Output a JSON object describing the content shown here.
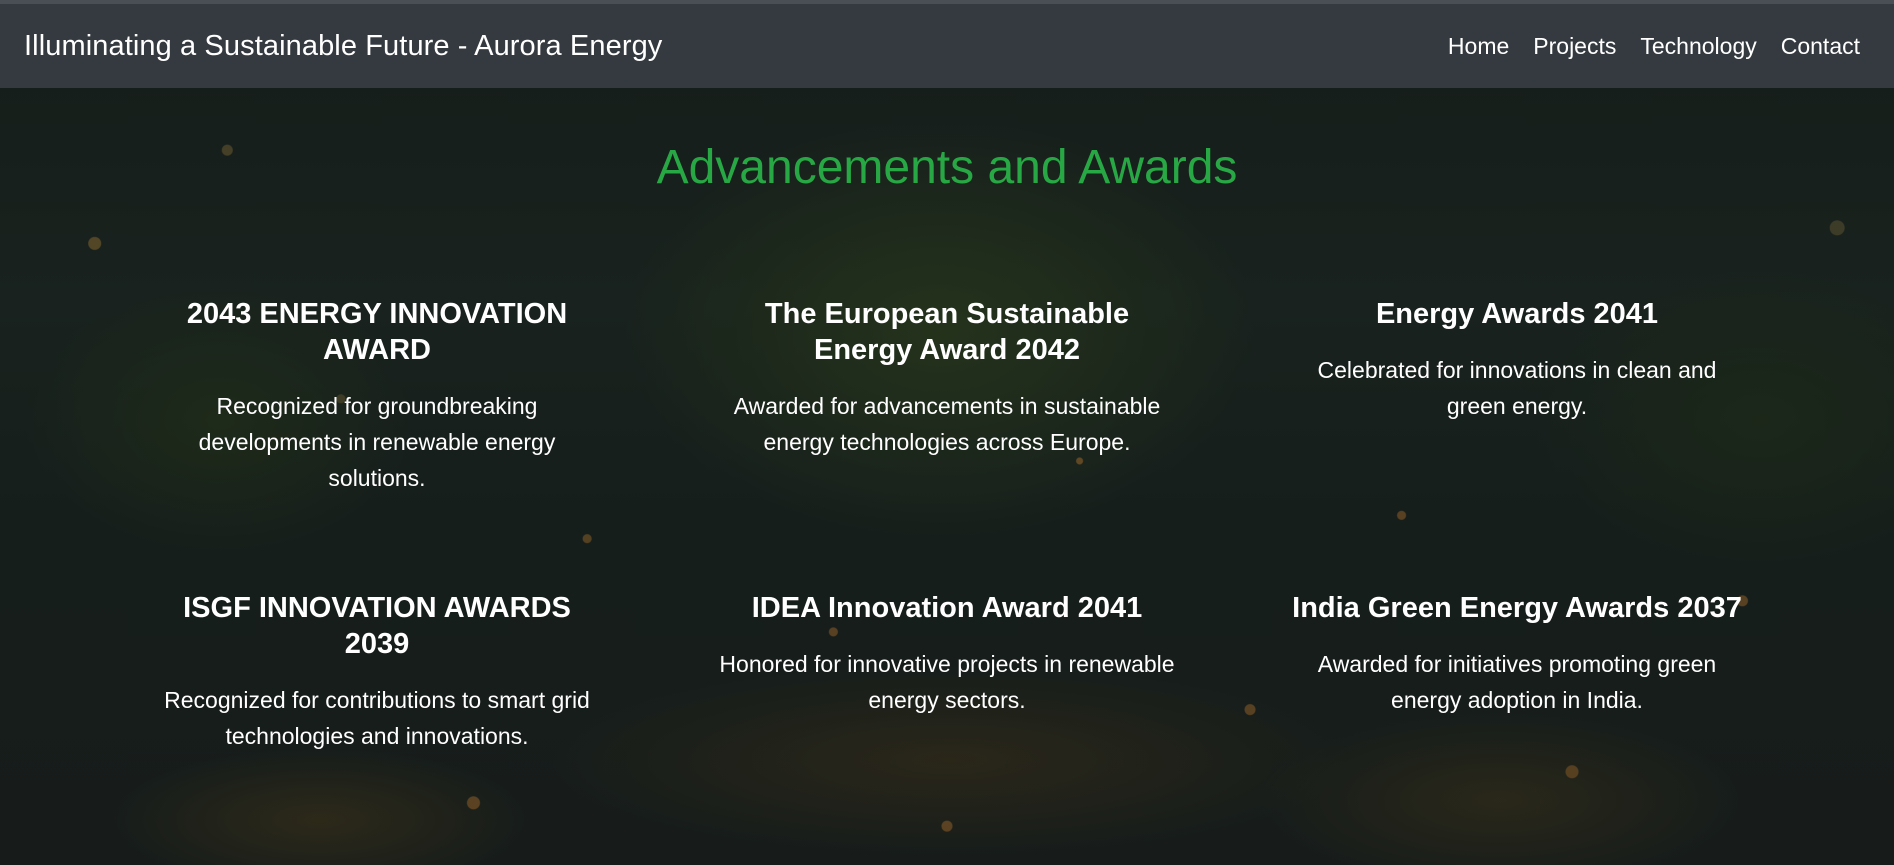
{
  "header": {
    "brand": "Illuminating a Sustainable Future - Aurora Energy",
    "nav": [
      {
        "label": "Home"
      },
      {
        "label": "Projects"
      },
      {
        "label": "Technology"
      },
      {
        "label": "Contact"
      }
    ]
  },
  "section": {
    "title": "Advancements and Awards",
    "title_color": "#28a745"
  },
  "awards": [
    {
      "title": "2043 ENERGY INNOVATION AWARD",
      "description": "Recognized for groundbreaking developments in renewable energy solutions."
    },
    {
      "title": "The European Sustainable Energy Award 2042",
      "description": "Awarded for advancements in sustainable energy technologies across Europe."
    },
    {
      "title": "Energy Awards 2041",
      "description": "Celebrated for innovations in clean and green energy."
    },
    {
      "title": "ISGF INNOVATION AWARDS 2039",
      "description": "Recognized for contributions to smart grid technologies and innovations."
    },
    {
      "title": "IDEA Innovation Award 2041",
      "description": "Honored for innovative projects in renewable energy sectors."
    },
    {
      "title": "India Green Energy Awards 2037",
      "description": "Awarded for initiatives promoting green energy adoption in India."
    }
  ],
  "colors": {
    "navbar_bg": "#343a40",
    "text": "#ffffff"
  }
}
